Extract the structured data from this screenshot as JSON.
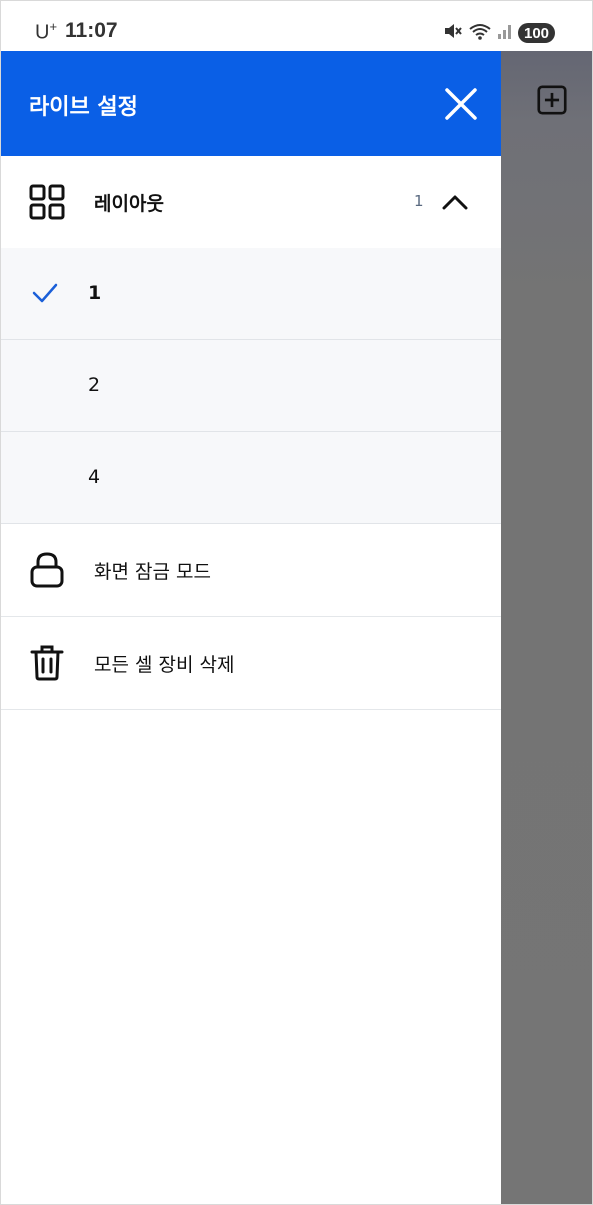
{
  "status_bar": {
    "carrier": "U",
    "carrier_sup": "+",
    "time": "11:07",
    "battery": "100"
  },
  "drawer": {
    "title": "라이브 설정",
    "layout_section": {
      "label": "레이아웃",
      "count": "1",
      "expanded": true,
      "options": [
        {
          "label": "1",
          "selected": true
        },
        {
          "label": "2",
          "selected": false
        },
        {
          "label": "4",
          "selected": false
        }
      ]
    },
    "screen_lock": {
      "label": "화면 잠금 모드"
    },
    "delete_all": {
      "label": "모든 셀 장비 삭제"
    }
  },
  "colors": {
    "header_blue": "#0a5fe6",
    "check_blue": "#1a5fd8",
    "backdrop_gray": "#757575"
  },
  "icons": {
    "layout": "grid-icon",
    "lock": "lock-icon",
    "trash": "trash-icon",
    "close": "close-icon",
    "chevron": "chevron-up-icon",
    "add": "add-square-icon",
    "check": "check-icon"
  }
}
